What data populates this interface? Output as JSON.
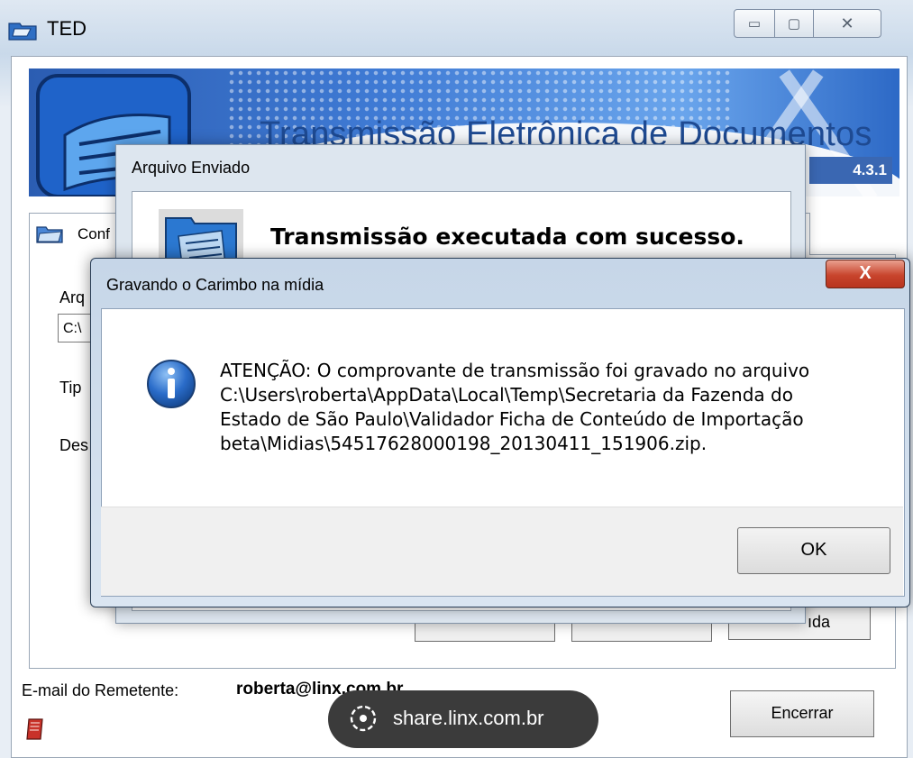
{
  "window": {
    "title": "TED",
    "buttons": {
      "minimize": "▭",
      "maximize": "▢",
      "close": "✕"
    }
  },
  "banner": {
    "title": "Transmissão Eletrônica de Documentos",
    "version": "4.3.1"
  },
  "tab": {
    "label": "Conf"
  },
  "form_fragments": {
    "arquivo": "Arq",
    "path": "C:\\",
    "tipo": "Tip",
    "destino": "Des",
    "button3": "ıda"
  },
  "footer": {
    "email_label": "E-mail do Remetente:",
    "email_value": "roberta@linx.com.br",
    "encerrar": "Encerrar"
  },
  "share": {
    "text": "share.linx.com.br"
  },
  "arquivo_dialog": {
    "title": "Arquivo Enviado",
    "message": "Transmissão executada com sucesso."
  },
  "gravando_dialog": {
    "title": "Gravando o Carimbo na mídia",
    "close": "X",
    "message": "ATENÇÃO: O comprovante de transmissão foi gravado no arquivo\nC:\\Users\\roberta\\AppData\\Local\\Temp\\Secretaria da Fazenda do\nEstado de São Paulo\\Validador Ficha de Conteúdo de Importação\nbeta\\Midias\\54517628000198_20130411_151906.zip.",
    "ok": "OK"
  },
  "colors": {
    "banner_blue": "#2b5db2",
    "title_blue": "#1e4a92",
    "close_red": "#c8442c"
  }
}
